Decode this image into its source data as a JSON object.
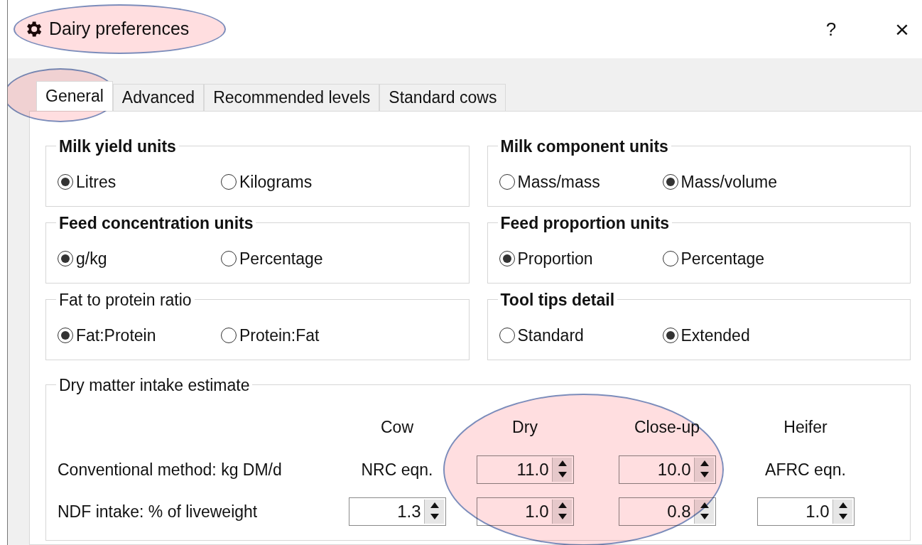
{
  "window": {
    "title": "Dairy preferences",
    "title_highlighted": true,
    "help": "?",
    "close": "×"
  },
  "tabs": [
    {
      "label": "General",
      "selected": true,
      "highlighted": true
    },
    {
      "label": "Advanced",
      "selected": false,
      "highlighted": false
    },
    {
      "label": "Recommended levels",
      "selected": false,
      "highlighted": false
    },
    {
      "label": "Standard cows",
      "selected": false,
      "highlighted": false
    }
  ],
  "groups": [
    {
      "title": "Milk yield units",
      "bold": true,
      "options": [
        {
          "label": "Litres",
          "selected": true
        },
        {
          "label": "Kilograms",
          "selected": false
        }
      ]
    },
    {
      "title": "Milk component units",
      "bold": true,
      "options": [
        {
          "label": "Mass/mass",
          "selected": false
        },
        {
          "label": "Mass/volume",
          "selected": true
        }
      ]
    },
    {
      "title": "Feed concentration units",
      "bold": true,
      "options": [
        {
          "label": "g/kg",
          "selected": true
        },
        {
          "label": "Percentage",
          "selected": false
        }
      ]
    },
    {
      "title": "Feed proportion units",
      "bold": true,
      "options": [
        {
          "label": "Proportion",
          "selected": true
        },
        {
          "label": "Percentage",
          "selected": false
        }
      ]
    },
    {
      "title": "Fat to protein ratio",
      "bold": false,
      "options": [
        {
          "label": "Fat:Protein",
          "selected": true
        },
        {
          "label": "Protein:Fat",
          "selected": false
        }
      ]
    },
    {
      "title": "Tool tips detail",
      "bold": true,
      "options": [
        {
          "label": "Standard",
          "selected": false
        },
        {
          "label": "Extended",
          "selected": true
        }
      ]
    }
  ],
  "intake": {
    "title": "Dry matter intake estimate",
    "columns": [
      {
        "label": "Cow",
        "highlighted": false
      },
      {
        "label": "Dry",
        "highlighted": true
      },
      {
        "label": "Close-up",
        "highlighted": true
      },
      {
        "label": "Heifer",
        "highlighted": false
      }
    ],
    "rows": [
      {
        "label": "Conventional method: kg DM/d",
        "cells": [
          {
            "kind": "text",
            "value": "NRC eqn."
          },
          {
            "kind": "spinner",
            "value": "11.0"
          },
          {
            "kind": "spinner",
            "value": "10.0"
          },
          {
            "kind": "text",
            "value": "AFRC eqn."
          }
        ]
      },
      {
        "label": "NDF intake: % of liveweight",
        "cells": [
          {
            "kind": "spinner",
            "value": "1.3"
          },
          {
            "kind": "spinner",
            "value": "1.0"
          },
          {
            "kind": "spinner",
            "value": "0.8"
          },
          {
            "kind": "spinner",
            "value": "1.0"
          }
        ]
      }
    ]
  }
}
